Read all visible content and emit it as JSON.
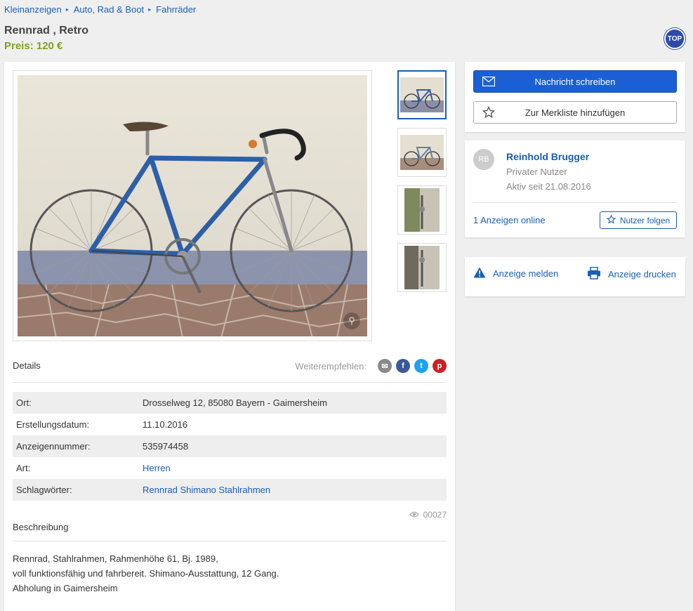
{
  "breadcrumb": {
    "items": [
      "Kleinanzeigen",
      "Auto, Rad & Boot",
      "Fahrräder"
    ]
  },
  "ad": {
    "title": "Rennrad , Retro",
    "price": "Preis: 120 €",
    "badge": "TOP"
  },
  "gallery": {
    "thumb_count": 4,
    "zoom_icon": "magnifier-icon"
  },
  "details": {
    "heading": "Details",
    "share_label": "Weiterempfehlen:",
    "share_icons": [
      "mail-icon",
      "facebook-icon",
      "twitter-icon",
      "pinterest-icon"
    ],
    "rows": [
      {
        "label": "Ort:",
        "value": "Drosselweg 12, 85080 Bayern - Gaimersheim"
      },
      {
        "label": "Erstellungsdatum:",
        "value": "11.10.2016"
      },
      {
        "label": "Anzeigennummer:",
        "value": "535974458"
      },
      {
        "label": "Art:",
        "value": "Herren"
      },
      {
        "label": "Schlagwörter:",
        "value": "Rennrad Shimano Stahlrahmen"
      }
    ],
    "views": "00027"
  },
  "description": {
    "heading": "Beschreibung",
    "lines": [
      "Rennrad, Stahlrahmen, Rahmenhöhe 61, Bj. 1989,",
      "voll funktionsfähig und fahrbereit. Shimano-Ausstattung, 12 Gang.",
      "Abholung in Gaimersheim"
    ]
  },
  "actions": {
    "message": "Nachricht schreiben",
    "watchlist": "Zur Merkliste hinzufügen"
  },
  "seller": {
    "initials": "RB",
    "name": "Reinhold Brugger",
    "type": "Privater Nutzer",
    "since": "Aktiv seit 21.08.2016",
    "ads_online": "1 Anzeigen online",
    "follow": "Nutzer folgen"
  },
  "misc": {
    "report": "Anzeige melden",
    "print": "Anzeige drucken"
  },
  "colors": {
    "link": "#1a5fb4",
    "price": "#7ba31f",
    "primary_button": "#1a5fd6",
    "top_badge": "#2c4aa8",
    "facebook": "#3b5998",
    "twitter": "#1da1f2",
    "pinterest": "#cb2027",
    "mail": "#8a8a8a"
  }
}
